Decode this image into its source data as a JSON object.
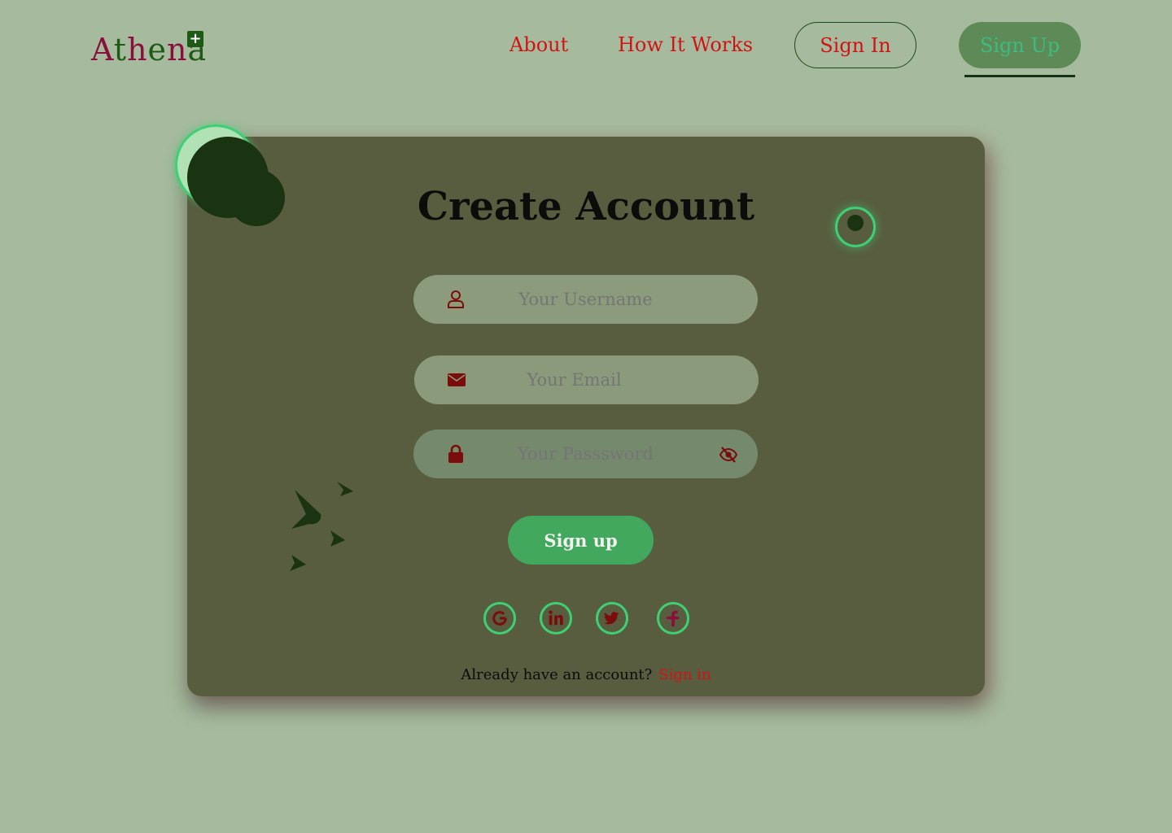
{
  "header": {
    "logo": {
      "letters": [
        "A",
        "t",
        "h",
        "e",
        "n",
        "a"
      ],
      "letter_colors": [
        "#8a0f3a",
        "#1d5a16",
        "#8a0f3a",
        "#1d5a16",
        "#8a0f3a",
        "#1d5a16"
      ],
      "badge_icon": "plus-icon"
    },
    "nav": [
      {
        "label": "About"
      },
      {
        "label": "How It Works"
      }
    ],
    "sign_in_label": "Sign In",
    "sign_up_label": "Sign Up"
  },
  "card": {
    "title": "Create Account",
    "fields": {
      "username": {
        "placeholder": "Your Username",
        "icon": "user-icon"
      },
      "email": {
        "placeholder": "Your Email",
        "icon": "envelope-icon"
      },
      "password": {
        "placeholder": "Your Passsword",
        "icon": "lock-icon",
        "toggle_icon": "eye-slash-icon"
      }
    },
    "submit_label": "Sign up",
    "social": [
      "google-icon",
      "linkedin-icon",
      "twitter-icon",
      "facebook-icon"
    ],
    "footer": {
      "question": "Already have an account?",
      "link_label": "Sign in"
    }
  },
  "colors": {
    "background": "#a6bb9e",
    "card": "#585d3f",
    "accent_red": "#d31313",
    "accent_green": "#42a85e",
    "icon_dark_red": "#7a0c0c",
    "ring_green": "#3fcf74"
  }
}
